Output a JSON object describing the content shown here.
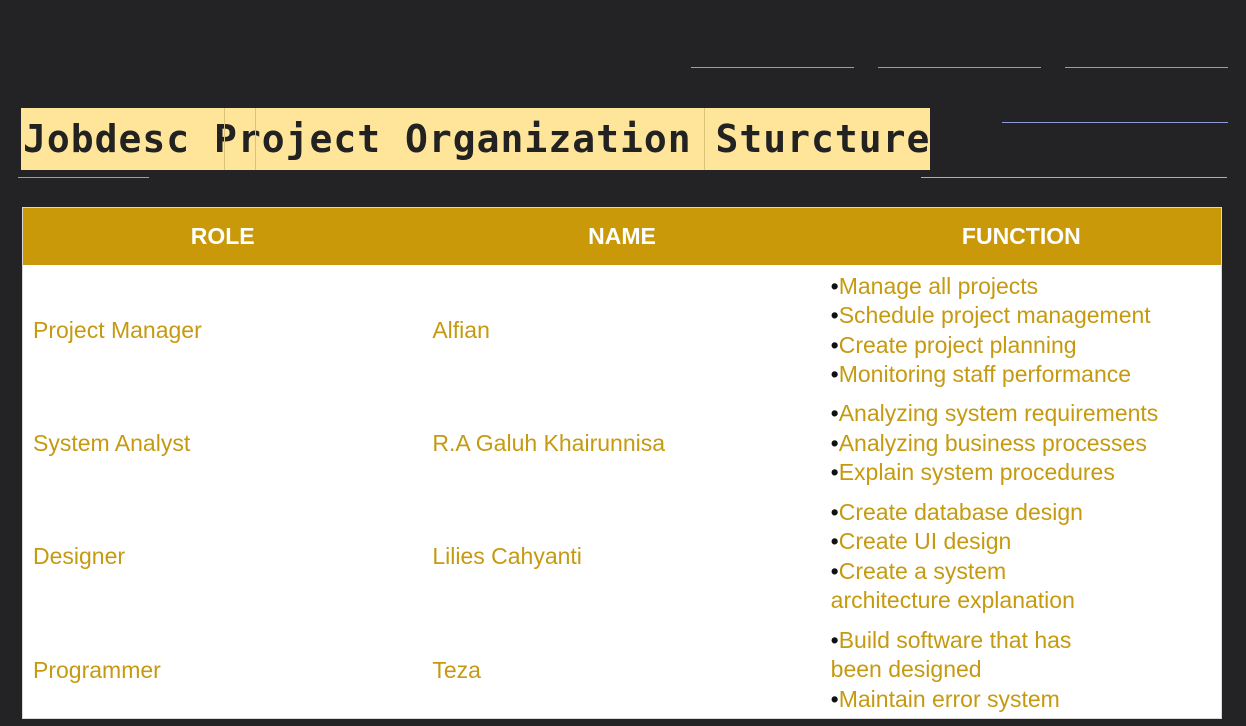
{
  "page": {
    "title": "Jobdesc Project Organization Sturcture"
  },
  "table": {
    "headers": [
      "ROLE",
      "NAME",
      "FUNCTION"
    ],
    "rows": [
      {
        "role": "Project Manager",
        "name": "Alfian",
        "functions": [
          "Manage all projects",
          "Schedule project management",
          "Create project planning",
          "Monitoring staff performance"
        ]
      },
      {
        "role": "System Analyst",
        "name": "R.A Galuh Khairunnisa",
        "functions": [
          "Analyzing system requirements",
          "Analyzing business processes",
          "Explain system procedures"
        ]
      },
      {
        "role": "Designer",
        "name": "Lilies Cahyanti",
        "functions": [
          "Create database design",
          "Create UI design",
          "Create a system architecture explanation"
        ]
      },
      {
        "role": "Programmer",
        "name": "Teza",
        "functions": [
          "Build software that has been designed",
          "Maintain error system"
        ]
      }
    ]
  },
  "colors": {
    "background": "#232325",
    "title_highlight": "#ffe599",
    "header": "#c9990a",
    "cell_text": "#c69a10"
  },
  "bullet_char": "•"
}
